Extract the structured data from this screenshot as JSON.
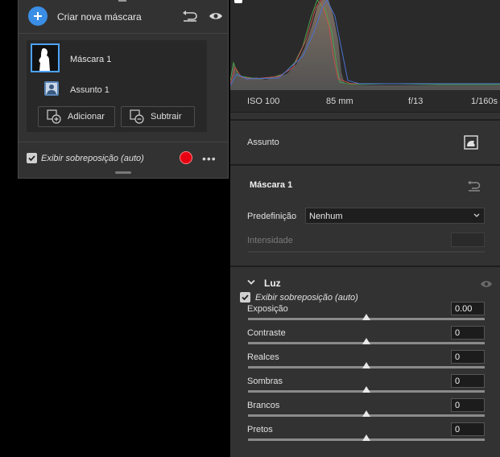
{
  "mask_panel": {
    "create_label": "Criar nova máscara",
    "masks": [
      {
        "name": "Máscara 1",
        "selected": true,
        "component": "Assunto 1"
      }
    ],
    "add_label": "Adicionar",
    "subtract_label": "Subtrair",
    "overlay_label": "Exibir sobreposição (auto)",
    "overlay_checked": true,
    "overlay_color": "#e60012",
    "icons": [
      "plus-icon",
      "reset-icon",
      "eye-icon",
      "mask-thumbnail",
      "subject-icon",
      "add-icon",
      "subtract-icon",
      "more-icon"
    ]
  },
  "histogram": {
    "meta": {
      "iso": "ISO 100",
      "focal": "85 mm",
      "aperture": "f/13",
      "shutter": "1/160s"
    }
  },
  "subject_row": {
    "label": "Assunto",
    "icon": "subject-select-icon"
  },
  "mask_settings": {
    "title": "Máscara 1",
    "preset_label": "Predefinição",
    "preset_value": "Nenhum",
    "intensity_label": "Intensidade",
    "intensity_value": ""
  },
  "light": {
    "title": "Luz",
    "overlay_label": "Exibir sobreposição (auto)",
    "overlay_checked": true,
    "sliders": [
      {
        "label": "Exposição",
        "value": "0.00",
        "position": 0.5
      },
      {
        "label": "Contraste",
        "value": "0",
        "position": 0.5
      },
      {
        "label": "Realces",
        "value": "0",
        "position": 0.5
      },
      {
        "label": "Sombras",
        "value": "0",
        "position": 0.5
      },
      {
        "label": "Brancos",
        "value": "0",
        "position": 0.5
      },
      {
        "label": "Pretos",
        "value": "0",
        "position": 0.5
      }
    ]
  },
  "colors": {
    "accent": "#3a8ee6",
    "selection": "#4da3ff",
    "panel": "#323232",
    "overlay_dot": "#e60012"
  }
}
